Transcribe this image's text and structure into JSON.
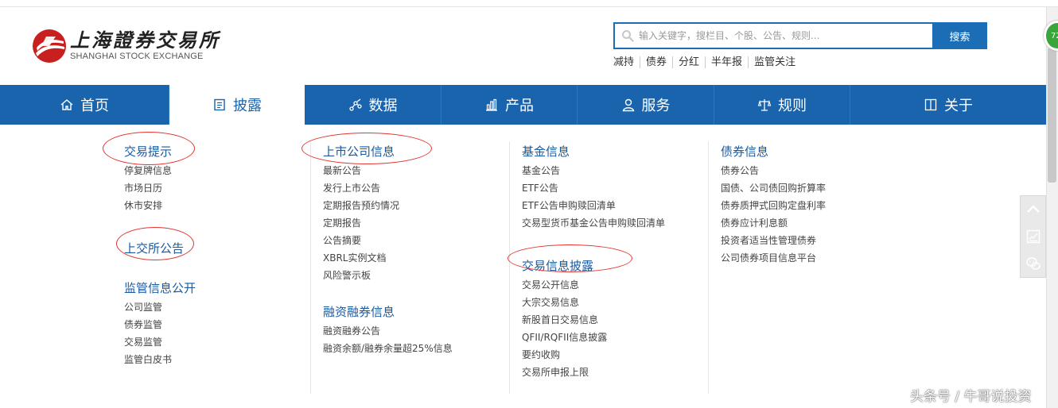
{
  "logo": {
    "cn": "上海證券交易所",
    "en": "SHANGHAI STOCK EXCHANGE",
    "colors": {
      "mark": "#c8201e"
    }
  },
  "search": {
    "placeholder": "输入关键字，搜栏目、个股、公告、规则...",
    "button_label": "搜索",
    "hot_links": [
      "减持",
      "债券",
      "分红",
      "半年报",
      "监管关注"
    ]
  },
  "online_badge": "72",
  "nav": {
    "active": "披露",
    "items": [
      {
        "label": "首页",
        "icon": "home-icon"
      },
      {
        "label": "披露",
        "icon": "document-icon"
      },
      {
        "label": "数据",
        "icon": "data-nodes-icon"
      },
      {
        "label": "产品",
        "icon": "bar-chart-icon"
      },
      {
        "label": "服务",
        "icon": "user-icon"
      },
      {
        "label": "规则",
        "icon": "scale-icon"
      },
      {
        "label": "关于",
        "icon": "book-icon"
      }
    ]
  },
  "menu": {
    "col1": {
      "sections": [
        {
          "title": "交易提示",
          "links": [
            "停复牌信息",
            "市场日历",
            "休市安排"
          ]
        },
        {
          "title": "上交所公告",
          "links": []
        },
        {
          "title": "监管信息公开",
          "links": [
            "公司监管",
            "债券监管",
            "交易监管",
            "监管白皮书"
          ]
        }
      ]
    },
    "col2": {
      "sections": [
        {
          "title": "上市公司信息",
          "links": [
            "最新公告",
            "发行上市公告",
            "定期报告预约情况",
            "定期报告",
            "公告摘要",
            "XBRL实例文档",
            "风险警示板"
          ]
        },
        {
          "title": "融资融券信息",
          "links": [
            "融资融券公告",
            "融资余额/融券余量超25%信息"
          ]
        }
      ]
    },
    "col3": {
      "sections": [
        {
          "title": "基金信息",
          "links": [
            "基金公告",
            "ETF公告",
            "ETF公告申购赎回清单",
            "交易型货币基金公告申购赎回清单"
          ]
        },
        {
          "title": "交易信息披露",
          "links": [
            "交易公开信息",
            "大宗交易信息",
            "新股首日交易信息",
            "QFII/RQFII信息披露",
            "要约收购",
            "交易所申报上限"
          ]
        }
      ]
    },
    "col4": {
      "sections": [
        {
          "title": "债券信息",
          "links": [
            "债券公告",
            "国债、公司债回购折算率",
            "债券质押式回购定盘利率",
            "债券应计利息额",
            "投资者适当性管理债券",
            "公司债券项目信息平台"
          ]
        }
      ]
    }
  },
  "float_tools": [
    "chevron-up-icon",
    "feedback-icon",
    "wechat-icon"
  ],
  "watermark": "头条号 / 牛哥说投资",
  "colors": {
    "nav_bg": "#1a64ad",
    "accent": "#1b6db5",
    "annotation": "#e3342f"
  }
}
